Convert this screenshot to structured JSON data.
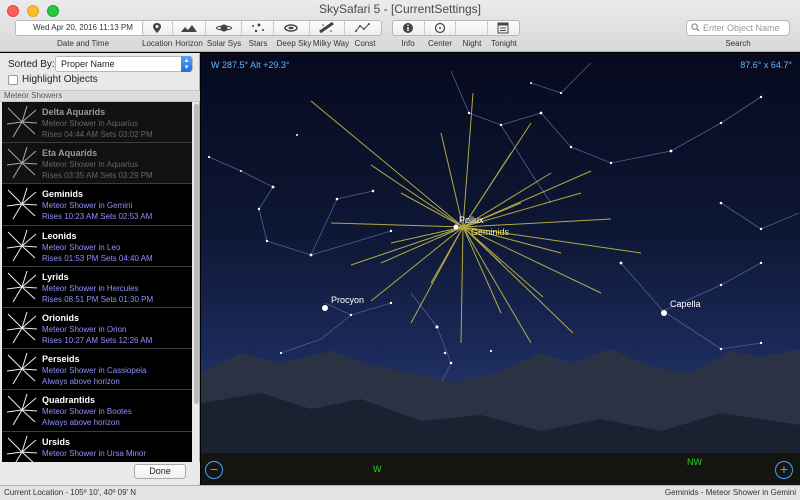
{
  "window": {
    "title": "SkySafari 5 - [CurrentSettings]"
  },
  "toolbar": {
    "datetime_value": "Wed Apr 20, 2016   11:13 PM",
    "datetime_label": "Date and Time",
    "view_buttons": [
      "Location",
      "Horizon",
      "Solar Sys",
      "Stars",
      "Deep Sky",
      "Milky Way",
      "Const"
    ],
    "action_buttons": [
      "Info",
      "Center",
      "Night",
      "Tonight"
    ],
    "search_placeholder": "Enter Object Name",
    "search_label": "Search"
  },
  "sidebar": {
    "sorted_by_label": "Sorted By:",
    "sort_value": "Proper Name",
    "highlight_label": "Highlight Objects",
    "section_title": "Meteor Showers",
    "items": [
      {
        "name": "Delta Aquarids",
        "type": "Meteor Shower in Aquarius",
        "times": "Rises 04:44 AM   Sets 03:02 PM"
      },
      {
        "name": "Eta Aquarids",
        "type": "Meteor Shower in Aquarius",
        "times": "Rises 03:35 AM   Sets 03:29 PM"
      },
      {
        "name": "Geminids",
        "type": "Meteor Shower in Gemini",
        "times": "Rises 10:23 AM   Sets 02:53 AM"
      },
      {
        "name": "Leonids",
        "type": "Meteor Shower in Leo",
        "times": "Rises 01:53 PM   Sets 04:40 AM"
      },
      {
        "name": "Lyrids",
        "type": "Meteor Shower in Hercules",
        "times": "Rises 08:51 PM   Sets 01:30 PM"
      },
      {
        "name": "Orionids",
        "type": "Meteor Shower in Orion",
        "times": "Rises 10:27 AM   Sets 12:26 AM"
      },
      {
        "name": "Perseids",
        "type": "Meteor Shower in Cassiopeia",
        "times": "Always above horizon"
      },
      {
        "name": "Quadrantids",
        "type": "Meteor Shower in Bootes",
        "times": "Always above horizon"
      },
      {
        "name": "Ursids",
        "type": "Meteor Shower in Ursa Minor",
        "times": ""
      }
    ],
    "done_label": "Done"
  },
  "sky": {
    "position_readout": "W 287.5° Alt +29.3°",
    "fov_readout": "87.6° x 64.7°",
    "labels": {
      "pollux": "Pollux",
      "geminids": "Geminids",
      "procyon": "Procyon",
      "capella": "Capella",
      "west": "W",
      "northwest": "NW"
    },
    "zoom_out": "−",
    "zoom_in": "+"
  },
  "status": {
    "location": "Current Location - 105º 10', 40º 09' N",
    "selection": "Geminids - Meteor Shower in Gemini"
  },
  "colors": {
    "readout": "#5eb8ff",
    "shower": "#f5e66b",
    "direction": "#2cd12c",
    "list_subtitle": "#8f8fff"
  }
}
